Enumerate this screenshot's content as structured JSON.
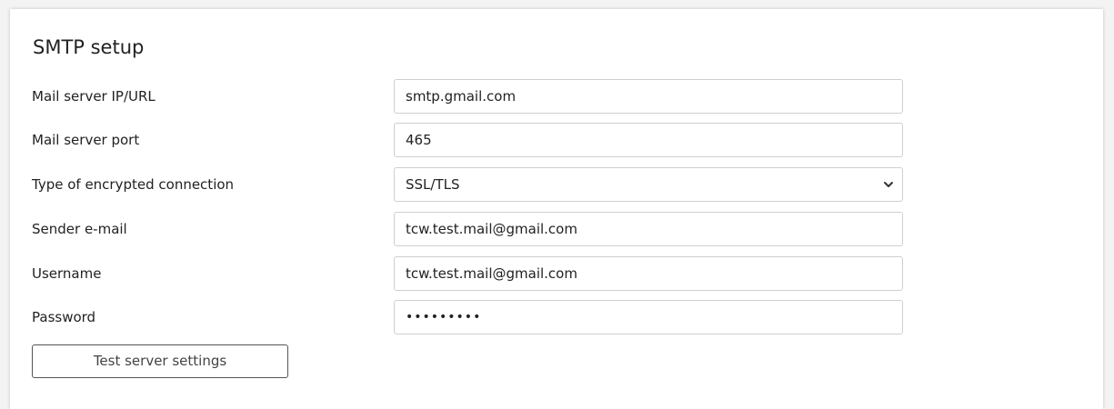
{
  "section": {
    "title": "SMTP setup"
  },
  "fields": {
    "server": {
      "label": "Mail server IP/URL",
      "value": "smtp.gmail.com"
    },
    "port": {
      "label": "Mail server port",
      "value": "465"
    },
    "encryption": {
      "label": "Type of encrypted connection",
      "value": "SSL/TLS"
    },
    "sender": {
      "label": "Sender e-mail",
      "value": "tcw.test.mail@gmail.com"
    },
    "username": {
      "label": "Username",
      "value": "tcw.test.mail@gmail.com"
    },
    "password": {
      "label": "Password",
      "value": "•••••••••"
    }
  },
  "actions": {
    "test_label": "Test server settings"
  },
  "icons": {
    "select_arrow": "chevron-down-icon"
  },
  "colors": {
    "background": "#f3f3f3",
    "card": "#ffffff",
    "border": "#cfcfcf",
    "button_border": "#555555"
  }
}
